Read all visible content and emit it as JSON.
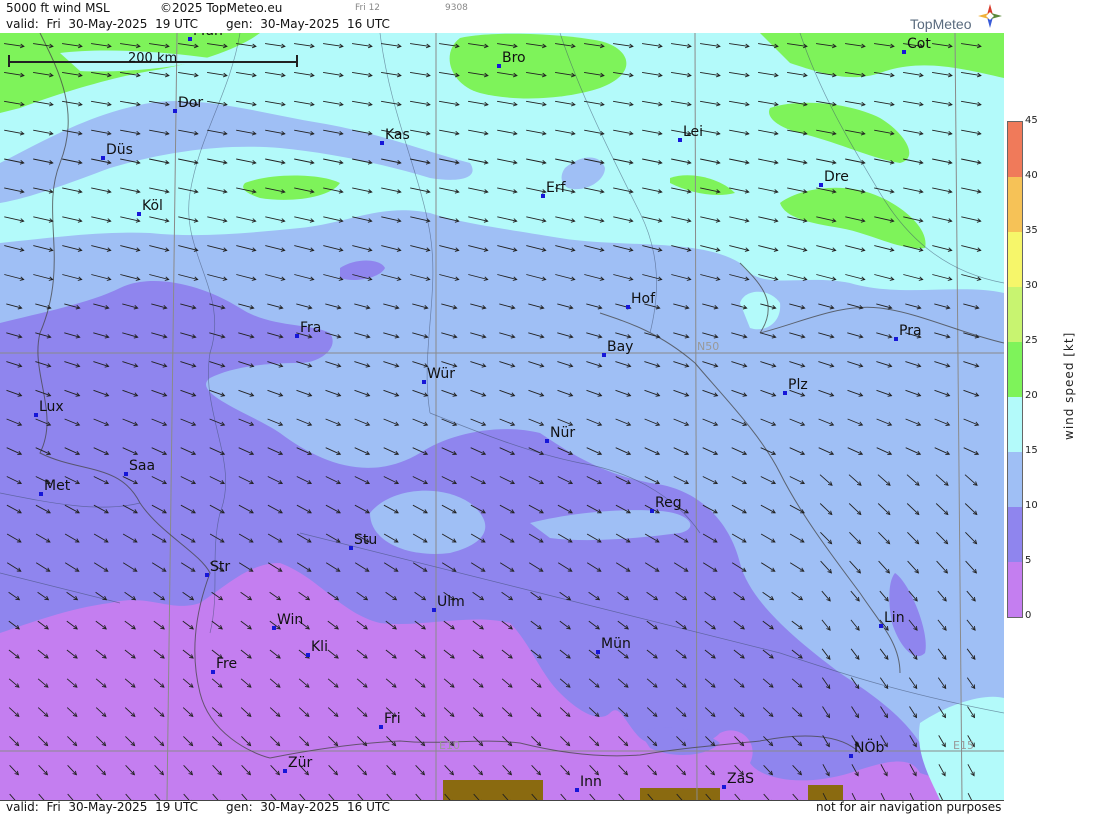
{
  "header": {
    "title": "5000 ft wind MSL",
    "copyright": "©2025 TopMeteo.eu",
    "valid_label": "valid:",
    "valid_day": "Fri",
    "valid_date": "30-May-2025",
    "valid_time": "19 UTC",
    "gen_label": "gen:",
    "gen_date": "30-May-2025",
    "gen_time": "16 UTC",
    "frame_label": "Fri 12",
    "frame_id": "9308"
  },
  "logo": {
    "text": "TopMeteo"
  },
  "scale": {
    "label": "200 km"
  },
  "grid_labels": {
    "lat": "N50",
    "lon_left": "E10",
    "lon_right": "E15"
  },
  "cities": [
    {
      "label": "Mün",
      "key": "mun-n"
    },
    {
      "label": "Bro",
      "key": "bro"
    },
    {
      "label": "Cot",
      "key": "cot"
    },
    {
      "label": "Dor",
      "key": "dor"
    },
    {
      "label": "Kas",
      "key": "kas"
    },
    {
      "label": "Lei",
      "key": "lei"
    },
    {
      "label": "Düs",
      "key": "dus"
    },
    {
      "label": "Erf",
      "key": "erf"
    },
    {
      "label": "Dre",
      "key": "dre"
    },
    {
      "label": "Köl",
      "key": "kol"
    },
    {
      "label": "Hof",
      "key": "hof"
    },
    {
      "label": "Fra",
      "key": "fra"
    },
    {
      "label": "Pra",
      "key": "pra"
    },
    {
      "label": "Bay",
      "key": "bay"
    },
    {
      "label": "Wür",
      "key": "wur"
    },
    {
      "label": "Plz",
      "key": "plz"
    },
    {
      "label": "Lux",
      "key": "lux"
    },
    {
      "label": "Nür",
      "key": "nur"
    },
    {
      "label": "Saa",
      "key": "saa"
    },
    {
      "label": "Met",
      "key": "met"
    },
    {
      "label": "Reg",
      "key": "reg"
    },
    {
      "label": "Stu",
      "key": "stu"
    },
    {
      "label": "Str",
      "key": "str"
    },
    {
      "label": "Ulm",
      "key": "ulm"
    },
    {
      "label": "Win",
      "key": "win"
    },
    {
      "label": "Lin",
      "key": "lin"
    },
    {
      "label": "Kli",
      "key": "kli"
    },
    {
      "label": "Mün",
      "key": "mun-s"
    },
    {
      "label": "Fre",
      "key": "fre"
    },
    {
      "label": "Fri",
      "key": "fri"
    },
    {
      "label": "NÖb",
      "key": "nob"
    },
    {
      "label": "Zür",
      "key": "zur"
    },
    {
      "label": "ZaS",
      "key": "zas"
    },
    {
      "label": "Inn",
      "key": "inn"
    }
  ],
  "legend": {
    "title": "wind speed [kt]",
    "ticks": [
      "45",
      "40",
      "35",
      "30",
      "25",
      "20",
      "15",
      "10",
      "5",
      "0"
    ],
    "colors": {
      "0-5": "#c47ef0",
      "5-10": "#8f85ee",
      "10-15": "#9fbff5",
      "15-20": "#b3fafa",
      "20-25": "#7ef35a",
      "25-30": "#c8f470",
      "30-35": "#f6f66a",
      "35-40": "#f6c257",
      "40-45": "#f07a5a"
    }
  },
  "footer": {
    "valid_label": "valid:",
    "valid_day": "Fri",
    "valid_date": "30-May-2025",
    "valid_time": "19 UTC",
    "gen_label": "gen:",
    "gen_date": "30-May-2025",
    "gen_time": "16 UTC",
    "disclaimer": "not for air navigation purposes"
  },
  "map_colors": {
    "calm": "#c47ef0",
    "light": "#8f85ee",
    "moderate": "#9fbff5",
    "fresh": "#b3fafa",
    "strong": "#7ef35a",
    "terrain": "#8a6a10"
  }
}
